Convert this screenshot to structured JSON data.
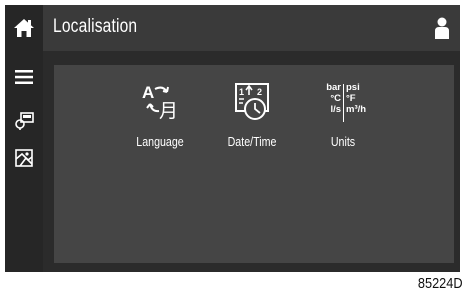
{
  "header": {
    "title": "Localisation"
  },
  "sidebar": {
    "items": [
      {
        "name": "home",
        "icon": "home-icon"
      },
      {
        "name": "menu",
        "icon": "menu-icon"
      },
      {
        "name": "controller",
        "icon": "controller-icon"
      },
      {
        "name": "map",
        "icon": "map-icon"
      }
    ]
  },
  "tiles": {
    "language": {
      "label": "Language",
      "icon": "language-icon"
    },
    "datetime": {
      "label": "Date/Time",
      "icon": "date-time-icon"
    },
    "units": {
      "label": "Units",
      "icon": "units-icon",
      "left": [
        "bar",
        "°C",
        "l/s"
      ],
      "right": [
        "psi",
        "°F",
        "m³/h"
      ]
    }
  },
  "footer": {
    "figure_id": "85224D"
  },
  "colors": {
    "background": "#2b2b2b",
    "header": "#3a3a3a",
    "panel": "#454545",
    "text": "#ffffff"
  }
}
